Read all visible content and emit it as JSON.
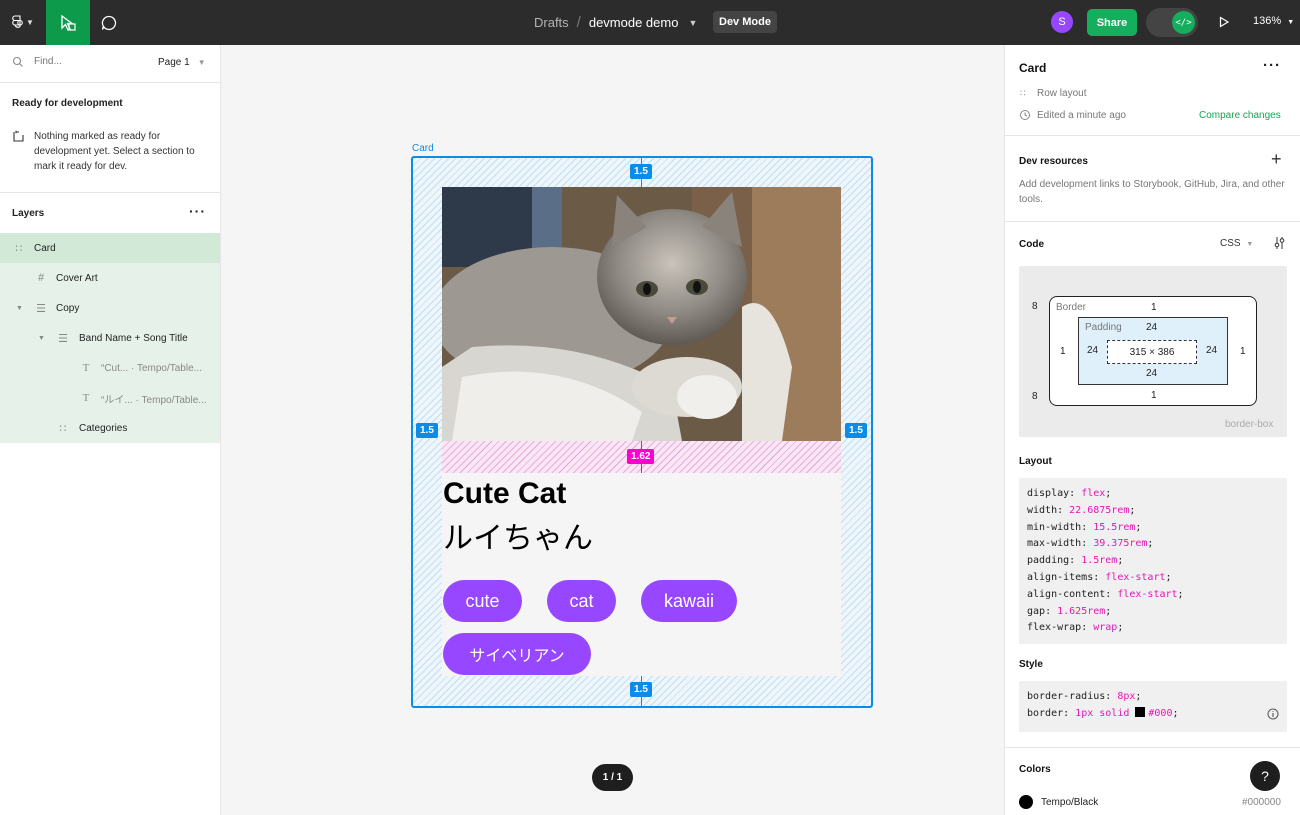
{
  "topbar": {
    "breadcrumb_root": "Drafts",
    "breadcrumb_sep": "/",
    "file_name": "devmode demo",
    "mode_badge": "Dev Mode",
    "avatar_initial": "S",
    "share_label": "Share",
    "zoom": "136%",
    "accent_color": "#14ae5c",
    "avatar_color": "#9747ff"
  },
  "left": {
    "search_placeholder": "Find...",
    "page": "Page 1",
    "ready_title": "Ready for development",
    "ready_text": "Nothing marked as ready for development yet. Select a section to mark it ready for dev.",
    "layers_title": "Layers",
    "layers": [
      {
        "name": "Card",
        "icon": "auto-layout-grid-icon"
      },
      {
        "name": "Cover Art",
        "icon": "frame-hash-icon"
      },
      {
        "name": "Copy",
        "icon": "vertical-layout-icon"
      },
      {
        "name": "Band Name + Song Title",
        "icon": "vertical-layout-icon"
      },
      {
        "name": "“Cut...",
        "sub": "· Tempo/Table...",
        "icon": "text-icon"
      },
      {
        "name": "“ルイ...",
        "sub": "· Tempo/Table...",
        "icon": "text-icon"
      },
      {
        "name": "Categories",
        "icon": "auto-layout-grid-icon"
      }
    ]
  },
  "canvas": {
    "frame_label": "Card",
    "padding_badge": "1.5",
    "gap_badge": "1.62",
    "title": "Cute Cat",
    "subtitle": "ルイちゃん",
    "tags": [
      "cute",
      "cat",
      "kawaii",
      "サイベリアン"
    ],
    "page_indicator": "1 / 1",
    "tag_color": "#9747ff"
  },
  "right": {
    "selection_name": "Card",
    "layout_type": "Row layout",
    "edited": "Edited a minute ago",
    "compare_link": "Compare changes",
    "dev_resources_title": "Dev resources",
    "dev_resources_text": "Add development links to Storybook, GitHub, Jira, and other tools.",
    "code_title": "Code",
    "code_lang": "CSS",
    "box_model": {
      "margin_label_top_left": "8",
      "margin_label_top_right": "8",
      "margin_label_bottom_left": "8",
      "margin_label_bottom_right": "8",
      "border_label": "Border",
      "border_top": "1",
      "border_bottom": "1",
      "border_left": "1",
      "border_right": "1",
      "padding_label": "Padding",
      "padding_top": "24",
      "padding_bottom": "24",
      "padding_left": "24",
      "padding_right": "24",
      "content_size": "315 × 386",
      "box_sizing": "border-box"
    },
    "layout_title": "Layout",
    "layout_css": [
      {
        "prop": "display",
        "val": "flex"
      },
      {
        "prop": "width",
        "val": "22.6875rem"
      },
      {
        "prop": "min-width",
        "val": "15.5rem"
      },
      {
        "prop": "max-width",
        "val": "39.375rem"
      },
      {
        "prop": "padding",
        "val": "1.5rem"
      },
      {
        "prop": "align-items",
        "val": "flex-start"
      },
      {
        "prop": "align-content",
        "val": "flex-start"
      },
      {
        "prop": "gap",
        "val": "1.625rem"
      },
      {
        "prop": "flex-wrap",
        "val": "wrap"
      }
    ],
    "style_title": "Style",
    "style_css": [
      {
        "prop": "border-radius",
        "val": "8px"
      },
      {
        "prop": "border",
        "val": "1px solid",
        "color": "#000"
      }
    ],
    "colors_title": "Colors",
    "color_name": "Tempo/Black",
    "color_hex": "#000000"
  }
}
